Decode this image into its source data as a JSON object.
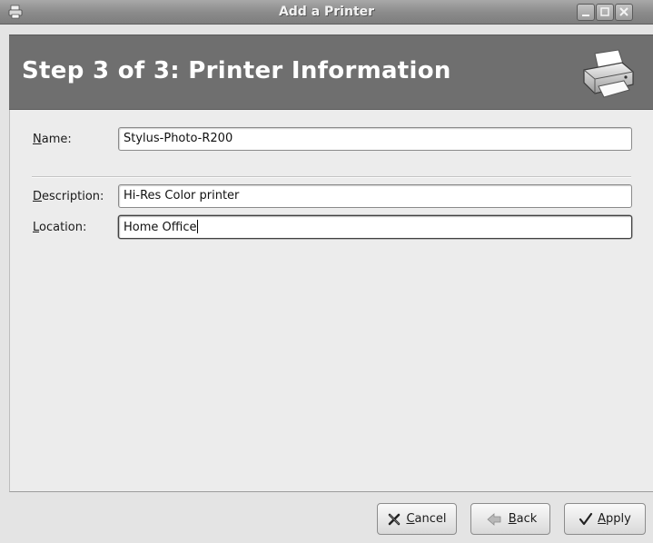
{
  "window": {
    "title": "Add a Printer",
    "controls": [
      "minimize",
      "maximize",
      "close"
    ]
  },
  "header": {
    "step_title": "Step 3 of 3: Printer Information",
    "icon": "printer-icon"
  },
  "form": {
    "name": {
      "label_first": "N",
      "label_rest": "ame:",
      "value": "Stylus-Photo-R200"
    },
    "description": {
      "label_first": "D",
      "label_rest": "escription:",
      "value": "Hi-Res Color printer"
    },
    "location": {
      "label_first": "L",
      "label_rest": "ocation:",
      "value": "Home Office"
    }
  },
  "buttons": {
    "cancel": {
      "label_first": "C",
      "label_rest": "ancel",
      "icon": "cancel-x-icon"
    },
    "back": {
      "label_first": "B",
      "label_rest": "ack",
      "icon": "back-arrow-icon"
    },
    "apply": {
      "label_first": "A",
      "label_rest": "pply",
      "icon": "checkmark-icon"
    }
  }
}
